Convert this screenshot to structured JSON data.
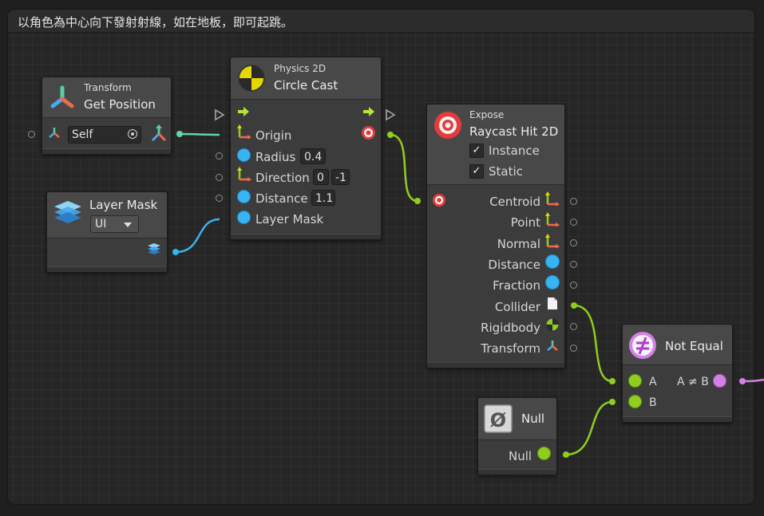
{
  "comment": "以角色為中心向下發射射線，如在地板，即可起跳。",
  "nodes": {
    "transform": {
      "category": "Transform",
      "title": "Get Position",
      "target_value": "Self"
    },
    "layer_mask": {
      "title": "Layer Mask",
      "selected": "UI"
    },
    "circle_cast": {
      "category": "Physics 2D",
      "title": "Circle Cast",
      "ports": {
        "origin": "Origin",
        "radius": "Radius",
        "direction": "Direction",
        "distance": "Distance",
        "layer_mask": "Layer Mask"
      },
      "values": {
        "radius": "0.4",
        "direction_x": "0",
        "direction_y": "-1",
        "distance": "1.1"
      }
    },
    "expose": {
      "category": "Expose",
      "title": "Raycast Hit 2D",
      "instance_label": "Instance",
      "static_label": "Static",
      "instance_checked": true,
      "static_checked": true,
      "outputs": [
        "Centroid",
        "Point",
        "Normal",
        "Distance",
        "Fraction",
        "Collider",
        "Rigidbody",
        "Transform"
      ]
    },
    "null": {
      "title": "Null",
      "output": "Null"
    },
    "not_equal": {
      "title": "Not Equal",
      "input_a": "A",
      "input_b": "B",
      "output": "A ≠ B"
    }
  },
  "colors": {
    "vector_port": "#5fd7a6",
    "float_port": "#38b4f2",
    "object_port": "#8fce1f",
    "bool_port": "#d381e6",
    "raycast_icon": "#e23c3c",
    "accent_yellow": "#e4d800"
  }
}
